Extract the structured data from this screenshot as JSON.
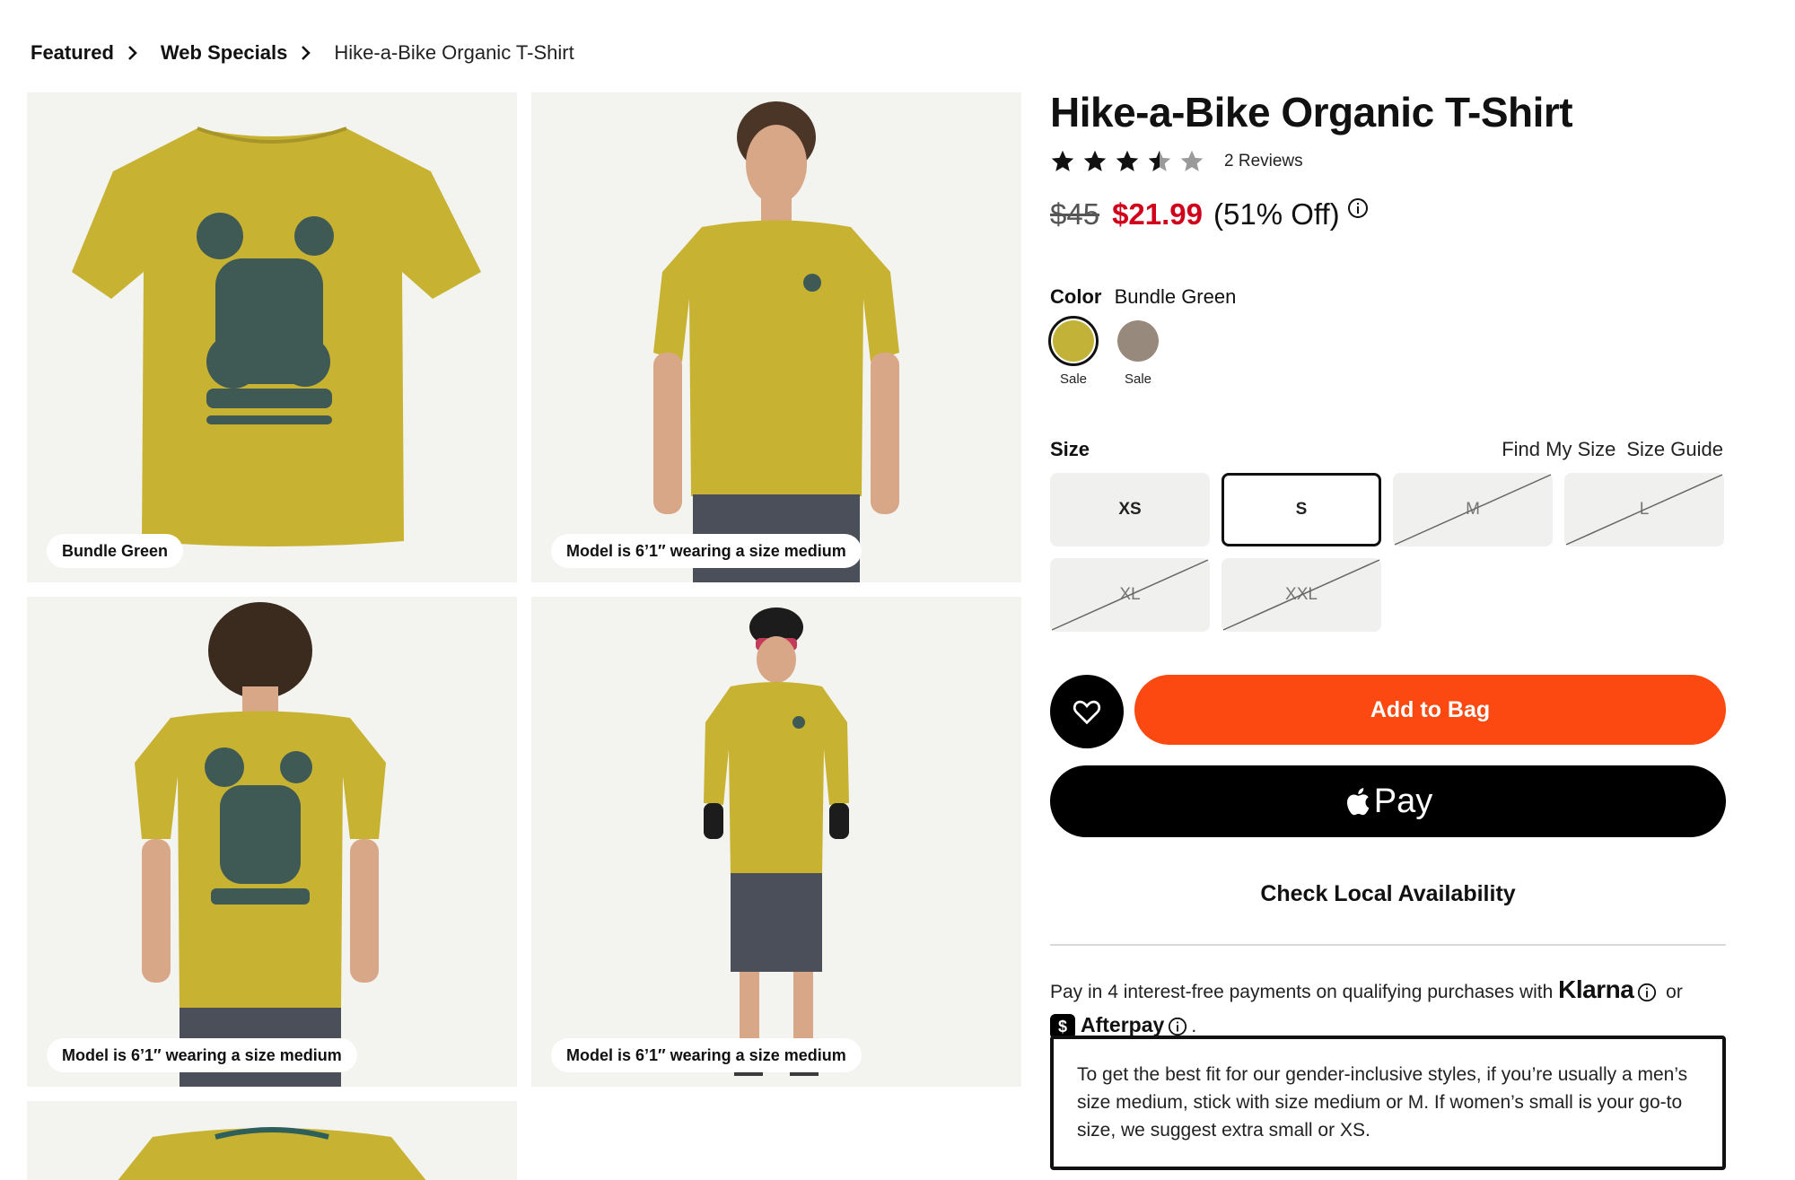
{
  "breadcrumb": {
    "items": [
      "Featured",
      "Web Specials"
    ],
    "current": "Hike-a-Bike Organic T-Shirt"
  },
  "gallery": {
    "captions": [
      "Bundle Green",
      "Model is 6’1″ wearing a size medium",
      "Model is 6’1″ wearing a size medium",
      "Model is 6’1″ wearing a size medium"
    ],
    "shirt_color": "#c8b232",
    "graphic_color": "#3f5a55"
  },
  "product": {
    "title": "Hike-a-Bike Organic T-Shirt",
    "rating": 3.5,
    "rating_max": 5,
    "reviews": "2 Reviews",
    "price_old": "$45",
    "price_new": "$21.99",
    "discount": "(51% Off)"
  },
  "color": {
    "label": "Color",
    "selected": "Bundle Green",
    "swatches": [
      {
        "tag": "Sale",
        "hex": "#c2b237",
        "selected": true
      },
      {
        "tag": "Sale",
        "hex": "#978a7c",
        "selected": false
      }
    ]
  },
  "size": {
    "label": "Size",
    "find_my_size": "Find My Size",
    "size_guide": "Size Guide",
    "options": [
      "XS",
      "S",
      "M",
      "L",
      "XL",
      "XXL"
    ],
    "selected": "S",
    "unavailable": [
      "M",
      "L",
      "XL",
      "XXL"
    ]
  },
  "actions": {
    "add_to_bag": "Add to Bag",
    "apple_pay": "Pay",
    "check_local": "Check Local Availability"
  },
  "payments": {
    "text": "Pay in 4 interest-free payments on qualifying purchases with",
    "klarna": "Klarna",
    "or": "or",
    "afterpay": "Afterpay",
    "period": "."
  },
  "fit_note": "To get the best fit for our gender-inclusive styles, if you’re usually a men’s size medium, stick with size medium or M. If women’s small is your go-to size, we suggest extra small or XS.",
  "colors": {
    "accent": "#fc4811",
    "sale_price": "#d0021b",
    "tile_bg": "#f3f3ef"
  }
}
